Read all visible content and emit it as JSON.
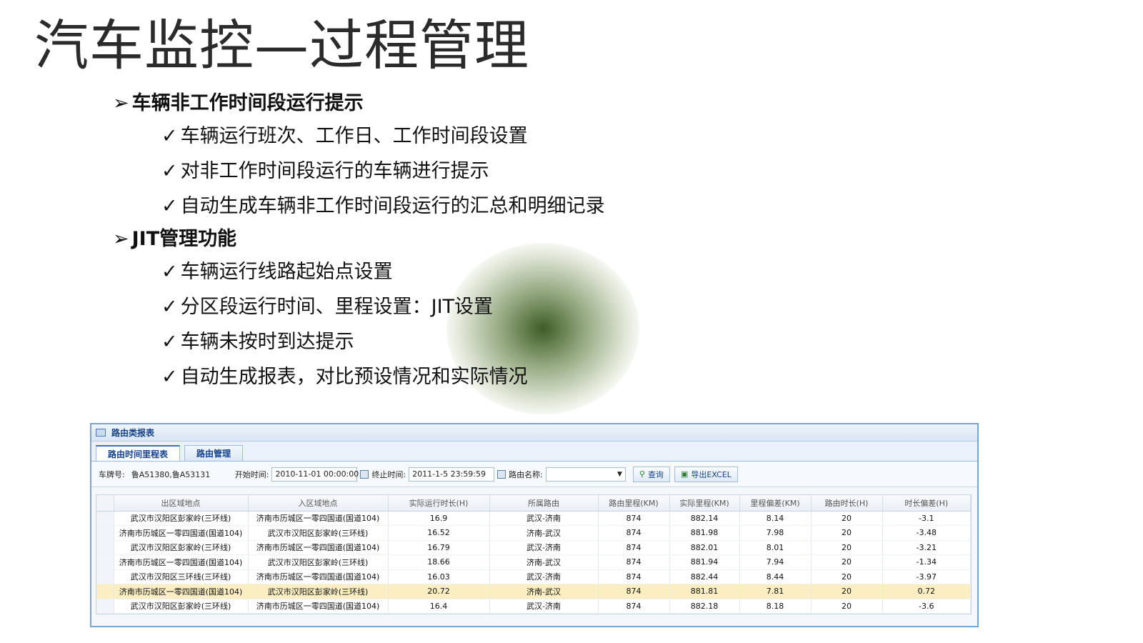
{
  "title": "汽车监控—过程管理",
  "outline": [
    {
      "heading": "车辆非工作时间段运行提示",
      "items": [
        "车辆运行班次、工作日、工作时间段设置",
        "对非工作时间段运行的车辆进行提示",
        "自动生成车辆非工作时间段运行的汇总和明细记录"
      ]
    },
    {
      "heading": "JIT管理功能",
      "items": [
        "车辆运行线路起始点设置",
        "分区段运行时间、里程设置：JIT设置",
        "车辆未按时到达提示",
        "自动生成报表，对比预设情况和实际情况"
      ]
    }
  ],
  "bullets": {
    "level1": "➢",
    "level2": "✓"
  },
  "report": {
    "panel_title": "路由类报表",
    "tabs": [
      "路由时间里程表",
      "路由管理"
    ],
    "toolbar": {
      "plate_label": "车牌号:",
      "plate_value": "鲁A51380,鲁A53131",
      "start_label": "开始时间:",
      "start_value": "2010-11-01 00:00:00",
      "end_label": "终止时间:",
      "end_value": "2011-1-5 23:59:59",
      "route_label": "路由名称:",
      "route_value": "",
      "query_label": "查询",
      "export_label": "导出EXCEL"
    },
    "columns": [
      "出区域地点",
      "入区域地点",
      "实际运行时长(H)",
      "所属路由",
      "路由里程(KM)",
      "实际里程(KM)",
      "里程偏差(KM)",
      "路由时长(H)",
      "时长偏差(H)"
    ],
    "rows": [
      [
        "武汉市汉阳区彭家岭(三环线)",
        "济南市历城区一零四国道(国道104)",
        "16.9",
        "武汉-济南",
        "874",
        "882.14",
        "8.14",
        "20",
        "-3.1"
      ],
      [
        "济南市历城区一零四国道(国道104)",
        "武汉市汉阳区彭家岭(三环线)",
        "16.52",
        "济南-武汉",
        "874",
        "881.98",
        "7.98",
        "20",
        "-3.48"
      ],
      [
        "武汉市汉阳区彭家岭(三环线)",
        "济南市历城区一零四国道(国道104)",
        "16.79",
        "武汉-济南",
        "874",
        "882.01",
        "8.01",
        "20",
        "-3.21"
      ],
      [
        "济南市历城区一零四国道(国道104)",
        "武汉市汉阳区彭家岭(三环线)",
        "18.66",
        "济南-武汉",
        "874",
        "881.94",
        "7.94",
        "20",
        "-1.34"
      ],
      [
        "武汉市汉阳区三环线(三环线)",
        "济南市历城区一零四国道(国道104)",
        "16.03",
        "武汉-济南",
        "874",
        "882.44",
        "8.44",
        "20",
        "-3.97"
      ],
      [
        "济南市历城区一零四国道(国道104)",
        "武汉市汉阳区彭家岭(三环线)",
        "20.72",
        "济南-武汉",
        "874",
        "881.81",
        "7.81",
        "20",
        "0.72"
      ],
      [
        "武汉市汉阳区彭家岭(三环线)",
        "济南市历城区一零四国道(国道104)",
        "16.4",
        "武汉-济南",
        "874",
        "882.18",
        "8.18",
        "20",
        "-3.6"
      ]
    ],
    "highlight_row": 5,
    "highlight_color": "#fbeec2",
    "accent_color": "#7aa6d4"
  }
}
